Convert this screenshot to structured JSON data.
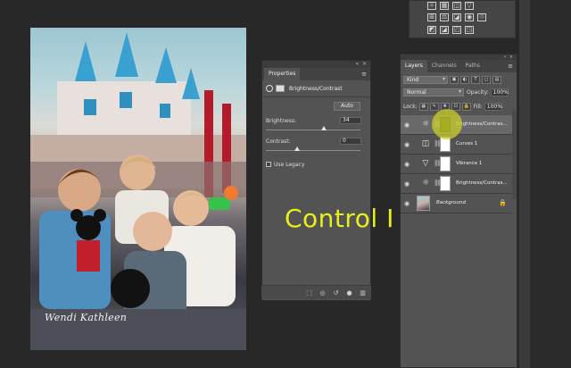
{
  "photo": {
    "signature": "Wendi Kathleen"
  },
  "tools_panel": {
    "row1": [
      "☼",
      "▦",
      "◫",
      "▽"
    ],
    "row2": [
      "⊞",
      "⚖",
      "◪",
      "◉",
      "♲"
    ],
    "row3": [
      "◩",
      "◪",
      "◰",
      "◳"
    ]
  },
  "properties": {
    "tab_label": "Properties",
    "layer_title": "Brightness/Contrast",
    "auto_label": "Auto",
    "brightness_label": "Brightness:",
    "brightness_value": "34",
    "brightness_level": 34,
    "contrast_label": "Contrast:",
    "contrast_value": "0",
    "contrast_level": 0,
    "legacy_label": "Use Legacy",
    "footer_icons": [
      "clip-to-layer-icon",
      "view-previous-icon",
      "reset-icon",
      "visibility-icon",
      "delete-icon"
    ]
  },
  "caption": {
    "text": "Control  I"
  },
  "layers": {
    "tabs": [
      "Layers",
      "Channels",
      "Paths"
    ],
    "filter_label": "Kind",
    "blend_mode": "Normal",
    "opacity_label": "Opacity:",
    "opacity_value": "100%",
    "lock_label": "Lock:",
    "fill_label": "Fill:",
    "fill_value": "100%",
    "items": [
      {
        "name": "Brightness/Contras...",
        "icon": "brightness-icon",
        "selected": true,
        "mask_dark": true
      },
      {
        "name": "Curves 1",
        "icon": "curves-icon",
        "selected": false,
        "mask_dark": false
      },
      {
        "name": "Vibrance 1",
        "icon": "vibrance-icon",
        "selected": false,
        "mask_dark": false
      },
      {
        "name": "Brightness/Contras...",
        "icon": "brightness-icon",
        "selected": false,
        "mask_dark": false
      },
      {
        "name": "Background",
        "icon": "image-thumbnail",
        "selected": false,
        "mask_dark": false,
        "locked": true
      }
    ]
  },
  "colors": {
    "caption": "#e9ef1a",
    "highlight": "#c8cd28"
  }
}
